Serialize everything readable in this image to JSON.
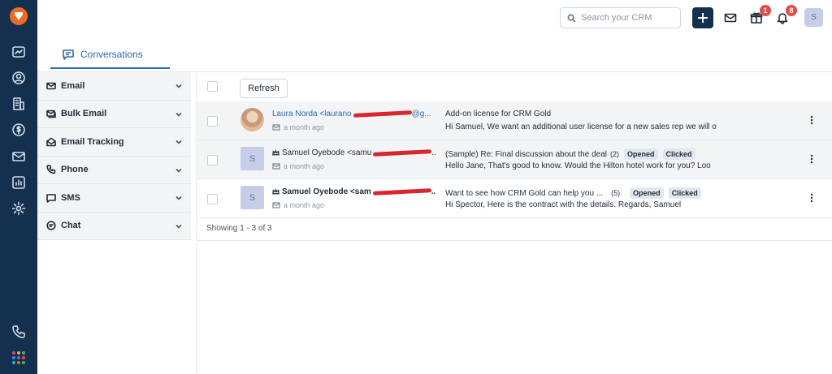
{
  "rail": {
    "items": [
      {
        "icon": "deals-icon"
      },
      {
        "icon": "contacts-icon"
      },
      {
        "icon": "accounts-icon"
      },
      {
        "icon": "revenue-icon"
      },
      {
        "icon": "inbox-icon"
      },
      {
        "icon": "reports-icon"
      },
      {
        "icon": "settings-icon"
      }
    ],
    "bottom_icon": "phone-icon",
    "apps_colors": [
      "#e34b4b",
      "#f2a93b",
      "#4cae6a",
      "#3b82f6",
      "#9b59b6",
      "#e34b4b",
      "#2bb3c0",
      "#f26a21",
      "#4cae6a"
    ]
  },
  "header": {
    "search_placeholder": "Search your CRM",
    "gift_badge": "1",
    "notification_badge": "8",
    "user_initial": "S"
  },
  "tabs": [
    {
      "label": "Conversations",
      "icon": "chat-bubble-icon"
    }
  ],
  "filters": [
    {
      "label": "Email",
      "icon": "mail-icon"
    },
    {
      "label": "Bulk Email",
      "icon": "bulk-mail-icon"
    },
    {
      "label": "Email Tracking",
      "icon": "tracking-icon"
    },
    {
      "label": "Phone",
      "icon": "phone-icon"
    },
    {
      "label": "SMS",
      "icon": "sms-icon"
    },
    {
      "label": "Chat",
      "icon": "chat-icon"
    }
  ],
  "toolbar": {
    "refresh_label": "Refresh"
  },
  "conversations": [
    {
      "avatar": "",
      "from": "Laura Norda <laurano",
      "from_tail": "@g...",
      "time": "a month ago",
      "subject": "Add-on license for CRM Gold",
      "count": "",
      "tags": [],
      "snippet": "Hi Samuel, We want an additional user license for a new sales rep we will o"
    },
    {
      "avatar": "S",
      "from": "Samuel Oyebode <samu",
      "from_tail": "..",
      "time": "a month ago",
      "subject": "(Sample) Re: Final discussion about the deal",
      "count": "(2)",
      "tags": [
        "Opened",
        "Clicked"
      ],
      "snippet": "Hello Jane, That's good to know. Would the Hilton hotel work for you? Loo"
    },
    {
      "avatar": "S",
      "from": "Samuel Oyebode <sam",
      "from_tail": "..",
      "time": "a month ago",
      "subject": "Want to see how CRM Gold can help you ...",
      "count": "(5)",
      "tags": [
        "Opened",
        "Clicked"
      ],
      "snippet": "Hi Spector, Here is the contract with the details. Regards, Samuel"
    }
  ],
  "footer": {
    "showing": "Showing 1 - 3 of 3"
  }
}
